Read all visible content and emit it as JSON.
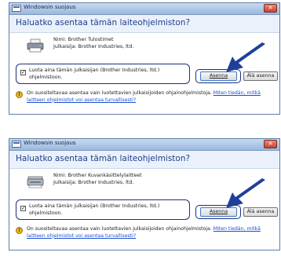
{
  "dialogs": [
    {
      "title": "Windowsin suojaus",
      "close_glyph": "✕",
      "heading": "Haluatko asentaa tämän laiteohjelmiston?",
      "name_line": "Nimi: Brother Tulostimet",
      "publisher_line": "Julkaisija: Brother Industries, ltd.",
      "trust_label": "Luota aina tämän julkaisijan (Brother Industries, ltd.) ohjelmistoon.",
      "checkbox_checked": true,
      "install_label": "Asenna",
      "dont_install_label": "Älä asenna",
      "warning_text": "On suositeltavaa asentaa vain luotettavien julkaisijoiden ohjainohjelmistoja.",
      "warning_link": "Miten tiedän, mitkä laitteen ohjelmistot voi asentaa turvallisesti?",
      "device_icon": "printer-icon"
    },
    {
      "title": "Windowsin suojaus",
      "close_glyph": "✕",
      "heading": "Haluatko asentaa tämän laiteohjelmiston?",
      "name_line": "Nimi: Brother Kuvankäsittelylaitteet",
      "publisher_line": "Julkaisija: Brother Industries, ltd.",
      "trust_label": "Luota aina tämän julkaisijan (Brother Industries, ltd.) ohjelmistoon.",
      "checkbox_checked": true,
      "install_label": "Asenna",
      "dont_install_label": "Älä asenna",
      "warning_text": "On suositeltavaa asentaa vain luotettavien julkaisijoiden ohjainohjelmistoja.",
      "warning_link": "Miten tiedän, mitkä laitteen ohjelmistot voi asentaa turvallisesti?",
      "device_icon": "scanner-icon"
    }
  ],
  "colors": {
    "heading": "#1d3f8a",
    "highlight_outline": "#1f2f7a",
    "arrow": "#1f3f9a",
    "link": "#1a4fd0"
  }
}
